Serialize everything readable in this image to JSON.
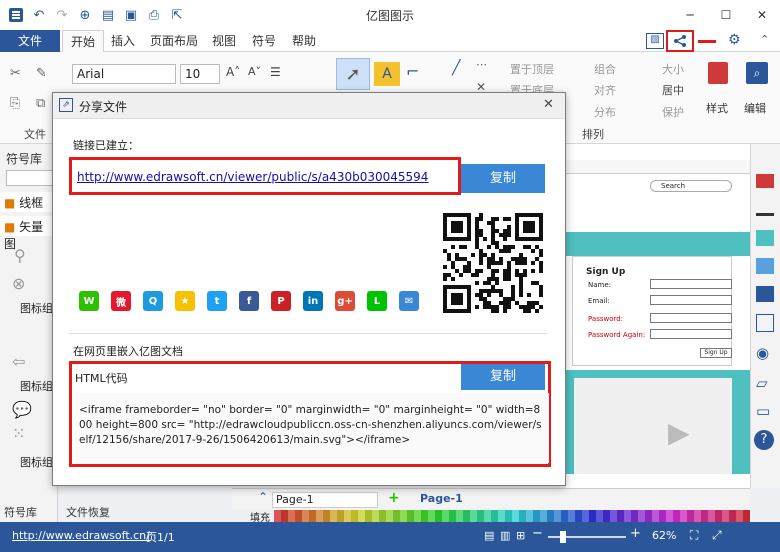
{
  "window": {
    "title": "亿图图示",
    "min": "─",
    "max": "☐",
    "close": "✕"
  },
  "ribbon": {
    "file_tab": "文件",
    "tabs": [
      "开始",
      "插入",
      "页面布局",
      "视图",
      "符号",
      "帮助"
    ],
    "font_name": "Arial",
    "font_size": "10",
    "group_file": "文件",
    "arrange_label": "排列",
    "bring_front": "置于顶层",
    "send_back": "置于底层",
    "group": "组合",
    "align": "对齐",
    "distribute": "分布",
    "size": "大小",
    "center": "居中",
    "protect": "保护",
    "style_label": "样式",
    "edit_label": "编辑"
  },
  "left": {
    "library_label": "符号库",
    "item_wireframe": "线框",
    "item_vector": "矢量图",
    "group1": "图标组",
    "group2": "图标组",
    "group3": "图标组",
    "bottom_tab1": "符号库",
    "bottom_tab2": "文件恢复"
  },
  "canvas": {
    "search": "Search",
    "signup_title": "Sign Up",
    "name": "Name:",
    "email": "Email:",
    "password": "Password:",
    "password_again": "Password Again:",
    "signup_btn": "Sign Up"
  },
  "pagebar": {
    "page1": "Page-1",
    "page1_active": "Page-1",
    "fill_label": "填充"
  },
  "dialog": {
    "title": "分享文件",
    "link_created": "链接已建立：",
    "link_url": "http://www.edrawsoft.cn/viewer/public/s/a430b030045594",
    "copy1": "复制",
    "embed_label": "在网页里嵌入亿图文档",
    "html_code_label": "HTML代码",
    "copy2": "复制",
    "embed_code": "<iframe frameborder= \"no\" border= \"0\" marginwidth= \"0\" marginheight= \"0\" width=800 height=800 src= \"http://edrawcloudpubliccn.oss-cn-shenzhen.aliyuncs.com/viewer/self/12156/share/2017-9-26/1506420613/main.svg\"></iframe>",
    "close": "✕"
  },
  "share_icons": [
    {
      "name": "wechat-icon",
      "color": "#2dc100",
      "glyph": "W"
    },
    {
      "name": "weibo-icon",
      "color": "#e6162d",
      "glyph": "微"
    },
    {
      "name": "qq-icon",
      "color": "#1e9bdc",
      "glyph": "Q"
    },
    {
      "name": "qzone-icon",
      "color": "#f5c100",
      "glyph": "★"
    },
    {
      "name": "twitter-icon",
      "color": "#1da1f2",
      "glyph": "t"
    },
    {
      "name": "facebook-icon",
      "color": "#3b5998",
      "glyph": "f"
    },
    {
      "name": "pinterest-icon",
      "color": "#cb2027",
      "glyph": "P"
    },
    {
      "name": "linkedin-icon",
      "color": "#0077b5",
      "glyph": "in"
    },
    {
      "name": "googleplus-icon",
      "color": "#dd4b39",
      "glyph": "g+"
    },
    {
      "name": "line-icon",
      "color": "#00c300",
      "glyph": "L"
    },
    {
      "name": "email-icon",
      "color": "#3a87d6",
      "glyph": "✉"
    }
  ],
  "status": {
    "url": "http://www.edrawsoft.cn/",
    "page": "页1/1",
    "zoom": "62%"
  },
  "colors": {
    "accent": "#2b579a",
    "red": "#e01b1b",
    "button": "#3a87d6",
    "teal": "#4fbfbf"
  }
}
